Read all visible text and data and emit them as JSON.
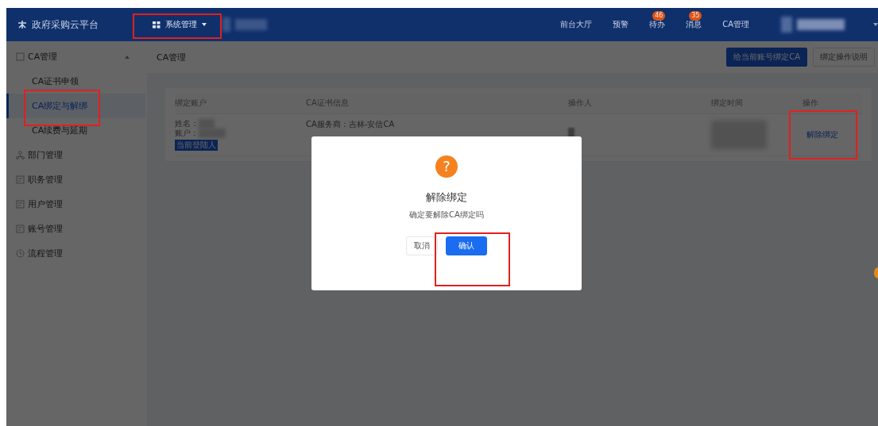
{
  "header": {
    "logo": "政府采购云平台",
    "system_menu": "系统管理",
    "nav": [
      {
        "label": "前台大厅"
      },
      {
        "label": "预警"
      },
      {
        "label": "待办",
        "badge": "46"
      },
      {
        "label": "消息",
        "badge": "35"
      },
      {
        "label": "CA管理"
      }
    ]
  },
  "sidebar": {
    "items": [
      {
        "label": "CA管理",
        "kind": "group",
        "expanded": true,
        "selected": false,
        "children": [
          {
            "label": "CA证书申领",
            "selected": false
          },
          {
            "label": "CA绑定与解绑",
            "selected": true
          },
          {
            "label": "CA续费与延期",
            "selected": false
          }
        ]
      },
      {
        "label": "部门管理",
        "kind": "org",
        "selected": false
      },
      {
        "label": "职务管理",
        "kind": "doc",
        "selected": false
      },
      {
        "label": "用户管理",
        "kind": "doc",
        "selected": false
      },
      {
        "label": "账号管理",
        "kind": "doc",
        "selected": false
      },
      {
        "label": "流程管理",
        "kind": "flow",
        "selected": false
      }
    ]
  },
  "breadcrumb": "CA管理",
  "toolbar_buttons": [
    {
      "label": "给当前账号绑定CA",
      "kind": "primary"
    },
    {
      "label": "绑定操作说明",
      "kind": "default"
    }
  ],
  "table": {
    "columns": [
      "绑定账户",
      "CA证书信息",
      "操作人",
      "绑定时间",
      "操作"
    ],
    "rows": [
      {
        "name_label": "姓名：",
        "account_label": "账户：",
        "tag": "当前登陆人",
        "certificate": "CA服务商：吉林-安信CA",
        "action": "解除绑定"
      }
    ]
  },
  "dialog": {
    "icon": "?",
    "title": "解除绑定",
    "message": "确定要解除CA绑定吗",
    "buttons": [
      {
        "label": "取消",
        "kind": "default"
      },
      {
        "label": "确认",
        "kind": "primary"
      }
    ]
  }
}
